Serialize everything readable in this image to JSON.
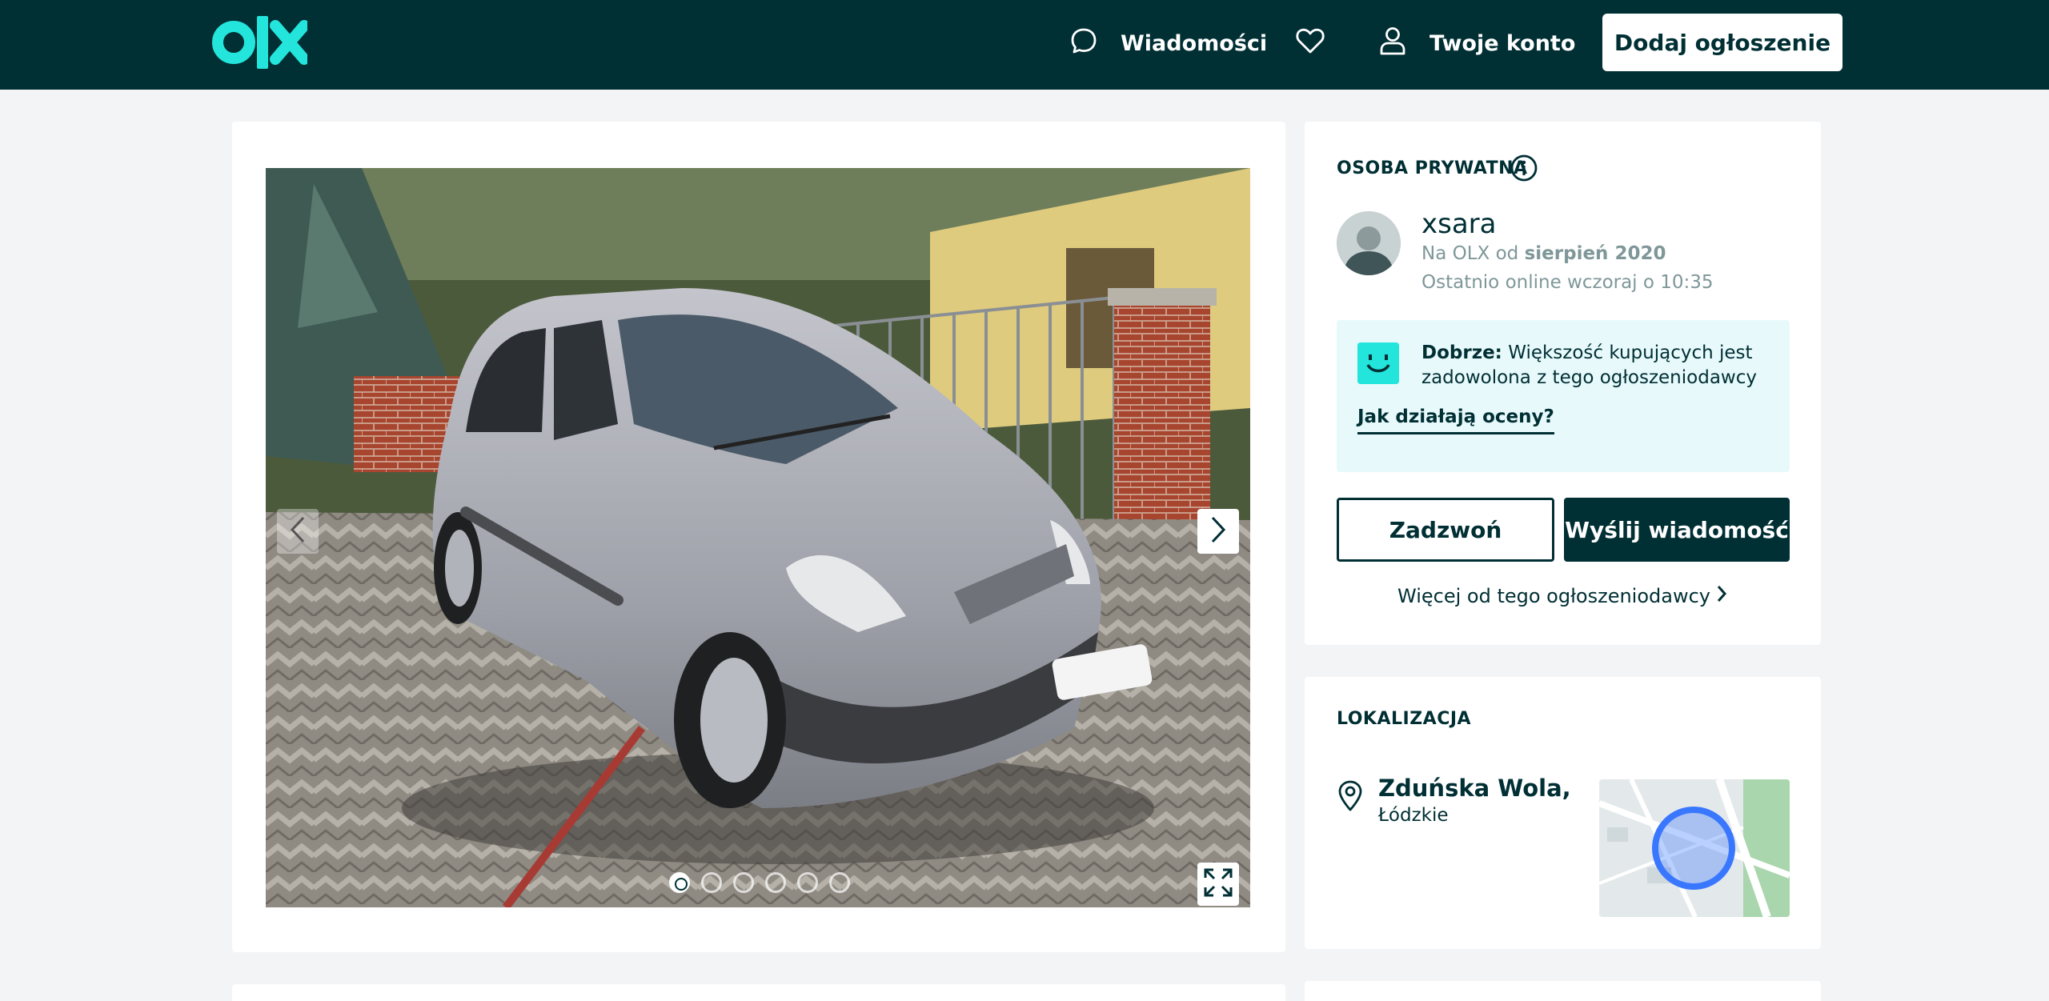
{
  "header": {
    "logo_text": "olx",
    "messages_label": "Wiadomości",
    "account_label": "Twoje konto",
    "add_listing_label": "Dodaj ogłoszenie"
  },
  "gallery": {
    "image_description": "photo of a silver compact MPV parked on paving stones",
    "image_count": 6,
    "active_index": 0
  },
  "seller": {
    "section_title": "OSOBA PRYWATNA",
    "name": "xsara",
    "since_prefix": "Na OLX od",
    "since_date": "sierpień 2020",
    "last_online": "Ostatnio online wczoraj o 10:35",
    "rating_label": "Dobrze:",
    "rating_text": "Większość kupujących jest zadowolona z tego ogłoszeniodawcy",
    "rating_link": "Jak działają oceny?",
    "call_button": "Zadzwoń",
    "message_button": "Wyślij wiadomość",
    "more_link": "Więcej od tego ogłoszeniodawcy"
  },
  "location": {
    "section_title": "LOKALIZACJA",
    "city": "Zduńska Wola,",
    "region": "Łódzkie"
  },
  "colors": {
    "brand_dark": "#002f34",
    "brand_teal": "#23e5db",
    "page_bg": "#f2f4f5",
    "rating_bg": "#e8f9fb",
    "map_circle": "#3a77ff"
  }
}
